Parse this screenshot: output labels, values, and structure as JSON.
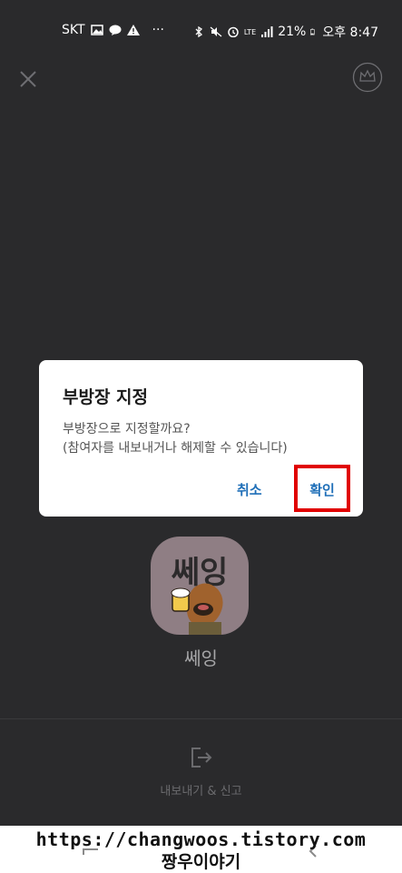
{
  "statusbar": {
    "carrier": "SKT",
    "dots": "···",
    "signal_type": "LTE",
    "battery": "21%",
    "time": "오후 8:47"
  },
  "dialog": {
    "title": "부방장 지정",
    "message_line1": "부방장으로 지정할까요?",
    "message_line2": "(참여자를 내보내거나 해제할 수 있습니다)",
    "cancel_label": "취소",
    "confirm_label": "확인"
  },
  "profile": {
    "avatar_text": "쎄잉",
    "name": "쎄잉"
  },
  "actions": {
    "kick_report_label": "내보내기 & 신고"
  },
  "watermark": {
    "url": "https://changwoos.tistory.com",
    "name": "짱우이야기"
  },
  "colors": {
    "background": "#2a2a2c",
    "accent_blue": "#1f6fb8",
    "highlight_red": "#e00000"
  }
}
